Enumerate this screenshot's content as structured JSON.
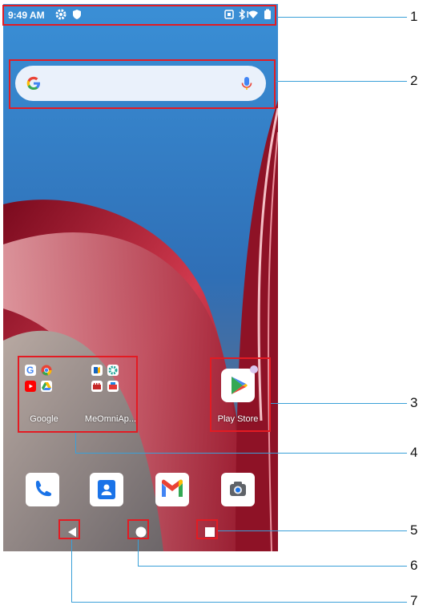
{
  "status_bar": {
    "time": "9:49 AM"
  },
  "search_bar": {
    "icon": "google-g-icon",
    "mic": "microphone-icon"
  },
  "folders": [
    {
      "label": "Google"
    },
    {
      "label": "MeOmniAp..."
    }
  ],
  "apps": [
    {
      "label": "Play Store"
    }
  ],
  "dock": [
    "phone-icon",
    "contacts-icon",
    "gmail-icon",
    "camera-icon"
  ],
  "callouts": [
    "1",
    "2",
    "3",
    "4",
    "5",
    "6",
    "7"
  ],
  "colors": {
    "annotation_red": "#e31b23",
    "leader_line": "#3aa0d8"
  }
}
